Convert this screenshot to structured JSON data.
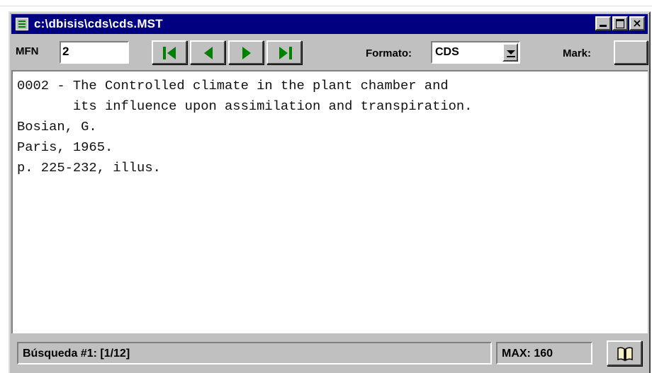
{
  "window": {
    "title": "c:\\dbisis\\cds\\cds.MST",
    "title_bar_color": "#000080"
  },
  "toolbar": {
    "mfn_label": "MFN",
    "mfn_value": "2",
    "nav_buttons": [
      "first-record",
      "previous-record",
      "next-record",
      "last-record"
    ],
    "nav_icon_color": "#008000",
    "formato_label": "Formato:",
    "formato_value": "CDS",
    "mark_label": "Mark:"
  },
  "record": {
    "lines": [
      "0002 - The Controlled climate in the plant chamber and",
      "       its influence upon assimilation and transpiration.",
      "Bosian, G.",
      "Paris, 1965.",
      "p. 225-232, illus."
    ]
  },
  "status": {
    "search": "Búsqueda #1: [1/12]",
    "max": "MAX: 160"
  }
}
